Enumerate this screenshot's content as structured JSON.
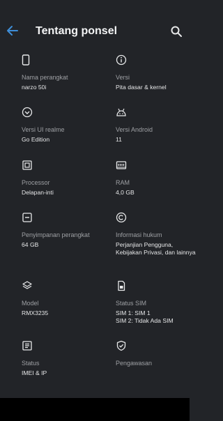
{
  "header": {
    "title": "Tentang ponsel"
  },
  "items": [
    {
      "label": "Nama perangkat",
      "value": "narzo 50i"
    },
    {
      "label": "Versi",
      "value": "Pita dasar & kernel"
    },
    {
      "label": "Versi UI realme",
      "value": "Go Edition"
    },
    {
      "label": "Versi Android",
      "value": "11"
    },
    {
      "label": "Processor",
      "value": "Delapan-inti"
    },
    {
      "label": "RAM",
      "value": "4,0 GB"
    },
    {
      "label": "Penyimpanan perangkat",
      "value": "64 GB"
    },
    {
      "label": "Informasi hukum",
      "value": "Perjanjian Pengguna, Kebijakan Privasi, dan lainnya"
    },
    {
      "label": "Model",
      "value": "RMX3235"
    },
    {
      "label": "Status SIM",
      "value": "SIM 1: SIM 1\nSIM 2: Tidak Ada SIM"
    },
    {
      "label": "Status",
      "value": "IMEI & IP"
    },
    {
      "label": "Pengawasan",
      "value": ""
    }
  ],
  "colors": {
    "accent": "#3e8ed8",
    "background": "#222428",
    "text": "#e8e9ea",
    "secondary": "#9ea0a4"
  }
}
